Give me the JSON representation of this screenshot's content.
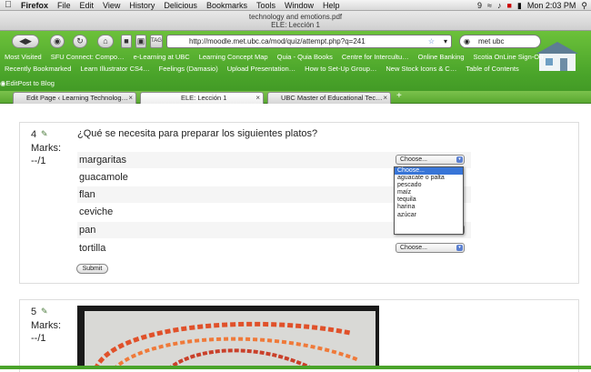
{
  "menubar": {
    "app": "Firefox",
    "items": [
      "File",
      "Edit",
      "View",
      "History",
      "Delicious",
      "Bookmarks",
      "Tools",
      "Window",
      "Help"
    ],
    "time": "Mon 2:03 PM",
    "icon_count": "9"
  },
  "window": {
    "doc_title": "technology and emotions.pdf",
    "page_title": "ELE: Lección 1"
  },
  "navbar": {
    "url": "http://moodle.met.ubc.ca/mod/quiz/attempt.php?q=241",
    "search_value": "met ubc"
  },
  "bookmarks": {
    "row1": [
      "Most Visited",
      "SFU Connect: Compo…",
      "e-Learning at UBC",
      "Learning Concept Map",
      "Quia - Quia Books",
      "Centre for Intercultu…",
      "Online Banking",
      "Scotia OnLine Sign-On"
    ],
    "row2": [
      "Recently Bookmarked",
      "Learn Illustrator CS4…",
      "Feelings (Damasio)",
      "Upload Presentation…",
      "How to Set-Up Group…",
      "New Stock Icons & C…",
      "Table of Contents"
    ],
    "row3": [
      "Edit",
      "Post to Blog"
    ]
  },
  "tabs": [
    {
      "label": "Edit Page ‹ Learning Technolog…"
    },
    {
      "label": "ELE: Lección 1"
    },
    {
      "label": "UBC Master of Educational Tec…"
    }
  ],
  "tabs_add": "+",
  "question4": {
    "number": "4",
    "marks_label": "Marks:",
    "marks_value": "--/1",
    "text": "¿Qué se necesita para preparar los siguientes platos?",
    "rows": [
      "margaritas",
      "guacamole",
      "flan",
      "ceviche",
      "pan",
      "tortilla"
    ],
    "select_placeholder": "Choose...",
    "submit_label": "Submit"
  },
  "dropdown_options": [
    "Choose...",
    "aguacate o palta",
    "pescado",
    "maíz",
    "tequila",
    "harina",
    "azúcar"
  ],
  "question5": {
    "number": "5",
    "marks_label": "Marks:",
    "marks_value": "--/1"
  },
  "colors": {
    "header_green": "#4aa42a",
    "highlight": "#3875d7"
  }
}
